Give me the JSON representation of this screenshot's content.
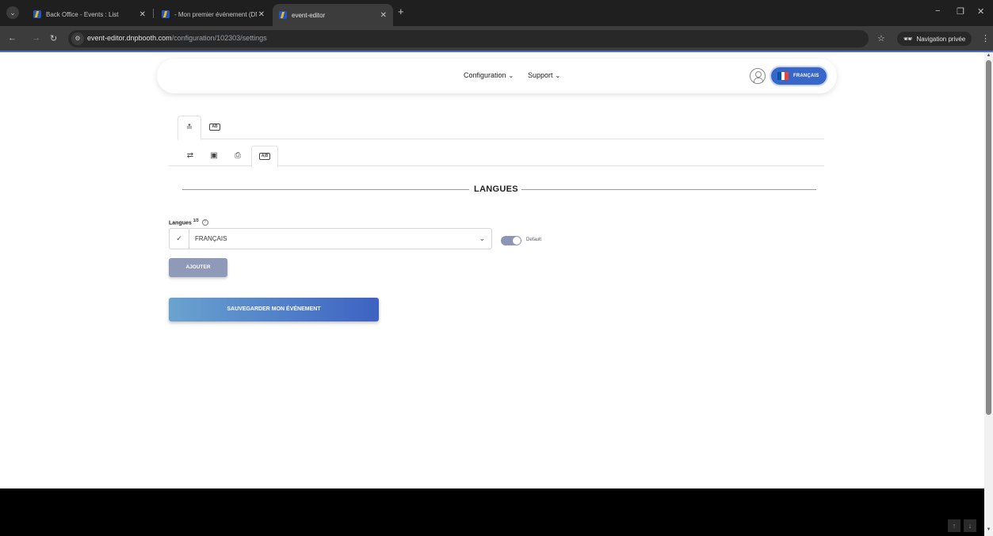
{
  "browser": {
    "tabs": [
      {
        "title": "Back Office - Events : List"
      },
      {
        "title": "- Mon premier événement (DN"
      },
      {
        "title": "event-editor"
      }
    ],
    "url_domain": "event-editor.dnpbooth.com",
    "url_path": "/configuration/102303/settings",
    "incognito_label": "Navigation privée"
  },
  "header": {
    "nav": [
      {
        "label": "Configuration"
      },
      {
        "label": "Support"
      }
    ],
    "language_button": "FRANÇAIS",
    "flag_colors": [
      "#0055a4",
      "#ffffff",
      "#ef4135"
    ]
  },
  "section": {
    "title": "LANGUES"
  },
  "languages": {
    "label": "Langues",
    "count": "1/3",
    "help_icon": "?",
    "selected": "FRANÇAIS",
    "default_label": "Default",
    "default_on": true
  },
  "buttons": {
    "add": "AJOUTER",
    "save": "SAUVEGARDER MON ÉVÉNEMENT"
  },
  "colors": {
    "accent": "#3867c9",
    "save_gradient_start": "#6aa3cf",
    "save_gradient_end": "#3d62c2",
    "add_button": "#8e9ab8"
  }
}
